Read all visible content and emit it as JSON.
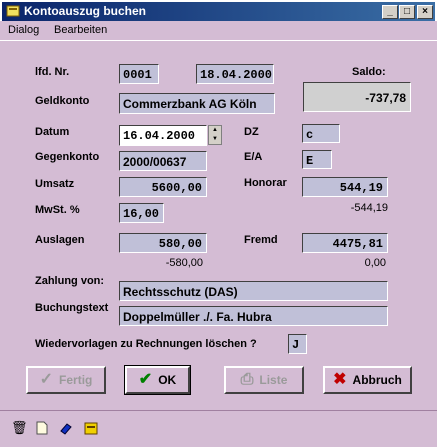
{
  "window": {
    "title": "Kontoauszug buchen"
  },
  "menu": {
    "dialog": "Dialog",
    "bearbeiten": "Bearbeiten"
  },
  "labels": {
    "lfd_nr": "lfd. Nr.",
    "saldo": "Saldo:",
    "geldkonto": "Geldkonto",
    "datum": "Datum",
    "dz": "DZ",
    "gegenkonto": "Gegenkonto",
    "ea": "E/A",
    "umsatz": "Umsatz",
    "honorar": "Honorar",
    "mwst": "MwSt. %",
    "auslagen": "Auslagen",
    "fremd": "Fremd",
    "zahlung_von": "Zahlung von:",
    "buchungstext": "Buchungstext",
    "wiedervorlagen": "Wiedervorlagen zu Rechnungen löschen ?"
  },
  "fields": {
    "lfd_nr": "0001",
    "date_top": "18.04.2000",
    "saldo": "-737,78",
    "geldkonto": "Commerzbank AG Köln",
    "datum": "16.04.2000",
    "dz": "c",
    "gegenkonto": "2000/00637",
    "ea": "E",
    "umsatz": "5600,00",
    "honorar": "544,19",
    "honorar_sub": "-544,19",
    "mwst": "16,00",
    "auslagen": "580,00",
    "auslagen_sub": "-580,00",
    "fremd": "4475,81",
    "fremd_sub": "0,00",
    "zahlung_von": "Rechtsschutz (DAS)",
    "buchungstext": "Doppelmüller ./. Fa. Hubra",
    "wiedervorlagen": "J"
  },
  "buttons": {
    "fertig": "Fertig",
    "ok": "OK",
    "liste": "Liste",
    "abbruch": "Abbruch"
  },
  "colors": {
    "titlebar": "#0a246a",
    "background": "#d4bcd4",
    "field": "#c0c0d8",
    "ok_check": "#008000",
    "abbruch_x": "#c00000"
  }
}
